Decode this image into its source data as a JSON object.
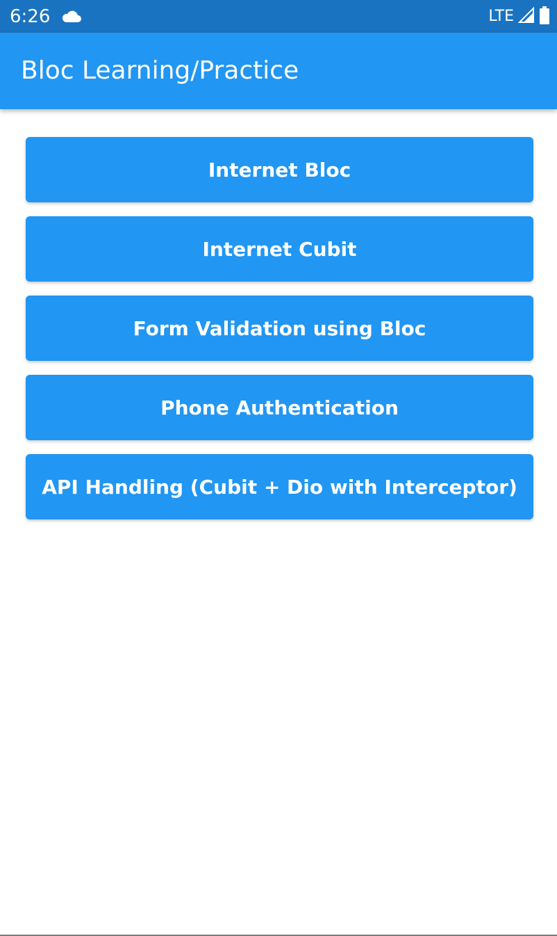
{
  "status_bar": {
    "time": "6:26",
    "network": "LTE",
    "cloud_icon": "cloud-icon",
    "signal_icon": "signal-icon",
    "battery_icon": "battery-icon"
  },
  "app_bar": {
    "title": "Bloc Learning/Practice",
    "color": "#2196f3"
  },
  "menu": {
    "buttons": [
      {
        "label": "Internet Bloc"
      },
      {
        "label": "Internet Cubit"
      },
      {
        "label": "Form Validation using Bloc"
      },
      {
        "label": "Phone Authentication"
      },
      {
        "label": "API Handling (Cubit + Dio with Interceptor)"
      }
    ]
  },
  "colors": {
    "status_bar": "#1a73c0",
    "accent": "#2196f3",
    "button_text": "#ffffff",
    "background": "#ffffff"
  }
}
